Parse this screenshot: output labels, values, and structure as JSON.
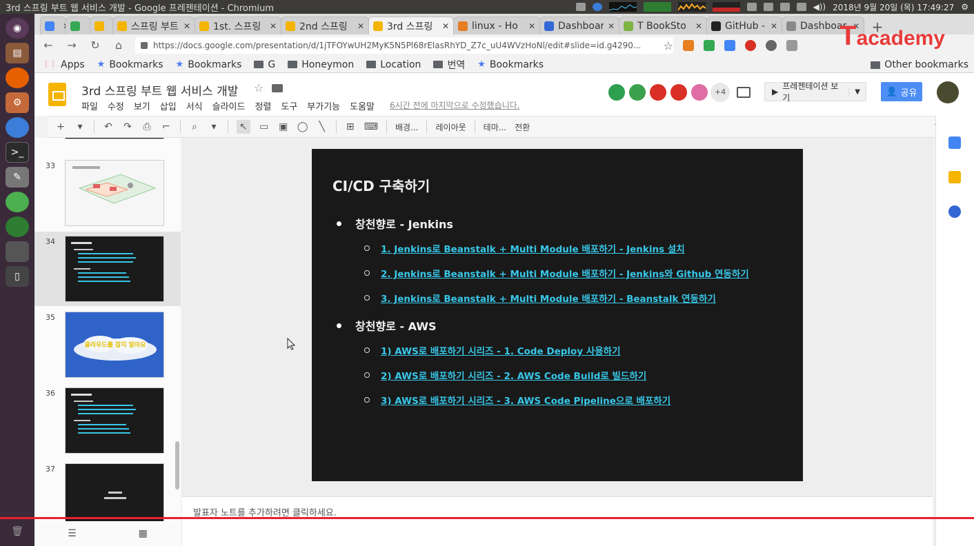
{
  "os": {
    "window_title": "3rd 스프링 부트 웹 서비스 개발 - Google 프레젠테이션 - Chromium",
    "clock": "2018년 9월 20일 (목) 17:49:27"
  },
  "launcher": [
    "ubuntu-dash-icon",
    "files-icon",
    "firefox-icon",
    "settings-icon",
    "chromium-icon",
    "terminal-icon",
    "text-editor-icon",
    "app-icon",
    "app-icon",
    "usb-icon",
    "trash-icon"
  ],
  "tabs": [
    {
      "label": "20",
      "color": "#4285f4"
    },
    {
      "label": "",
      "color": "#34a853"
    },
    {
      "label": "",
      "color": "#f4b400"
    },
    {
      "label": "스프링 부트",
      "color": "#f4b400"
    },
    {
      "label": "1st. 스프링",
      "color": "#f4b400"
    },
    {
      "label": "2nd 스프링",
      "color": "#f4b400"
    },
    {
      "label": "3rd 스프링",
      "color": "#f4b400",
      "active": true
    },
    {
      "label": "linux - Ho",
      "color": "#e67e22"
    },
    {
      "label": "Dashboar",
      "color": "#3367d6"
    },
    {
      "label": "T BookSto",
      "color": "#7cb342"
    },
    {
      "label": "GitHub - ",
      "color": "#222222"
    },
    {
      "label": "Dashboar",
      "color": "#888888"
    }
  ],
  "toolbar": {
    "url": "https://docs.google.com/presentation/d/1jTFOYwUH2MyK5N5Pl68rElasRhYD_Z7c_uU4WVzHoNl/edit#slide=id.g4290..."
  },
  "bookmarks": {
    "items": [
      {
        "label": "Apps",
        "icon": "apps-grid-icon"
      },
      {
        "label": "Bookmarks",
        "icon": "star-icon"
      },
      {
        "label": "Bookmarks",
        "icon": "star-icon"
      },
      {
        "label": "G",
        "icon": "folder-icon"
      },
      {
        "label": "Honeymon",
        "icon": "folder-icon"
      },
      {
        "label": "Location",
        "icon": "folder-icon"
      },
      {
        "label": "번역",
        "icon": "folder-icon"
      },
      {
        "label": "Bookmarks",
        "icon": "star-icon"
      }
    ],
    "other": "Other bookmarks"
  },
  "app": {
    "doc_title": "3rd 스프링 부트 웹 서비스 개발",
    "menu": [
      "파일",
      "수정",
      "보기",
      "삽입",
      "서식",
      "슬라이드",
      "정렬",
      "도구",
      "부가기능",
      "도움말"
    ],
    "last_edit": "6시간 전에 마지막으로 수정했습니다.",
    "collaborator_colors": [
      "#2e9e4f",
      "#3aa04b",
      "#d93025",
      "#d93025",
      "#e06ea5"
    ],
    "more_collaborators": "+4",
    "present_label": "프레젠테이션 보기",
    "share_label": "공유"
  },
  "edit_toolbar": {
    "background": "배경...",
    "layout": "레이아웃",
    "theme": "테마...",
    "transition": "전환"
  },
  "filmstrip": [
    {
      "num": "33",
      "kind": "diagram"
    },
    {
      "num": "34",
      "kind": "text",
      "selected": true
    },
    {
      "num": "35",
      "kind": "cloud",
      "caption": "클라우드를 잡지 말아요"
    },
    {
      "num": "36",
      "kind": "text"
    },
    {
      "num": "37",
      "kind": "dark"
    }
  ],
  "slide": {
    "title": "CI/CD 구축하기",
    "sections": [
      {
        "heading": "창천향로 - Jenkins",
        "links": [
          "1. Jenkins로 Beanstalk + Multi Module 배포하기 - Jenkins 설치",
          "2. Jenkins로 Beanstalk + Multi Module 배포하기 - Jenkins와 Github 연동하기",
          "3. Jenkins로 Beanstalk + Multi Module 배포하기 - Beanstalk 연동하기"
        ]
      },
      {
        "heading": "창천향로 - AWS",
        "links": [
          "1) AWS로 배포하기 시리즈 - 1. Code Deploy 사용하기",
          "2) AWS로 배포하기 시리즈 - 2. AWS Code Build로 빌드하기",
          "3) AWS로 배포하기 시리즈 - 3. AWS Code Pipeline으로 배포하기"
        ]
      }
    ]
  },
  "notes_placeholder": "발표자 노트를 추가하려면 클릭하세요.",
  "watermark": "Tacademy",
  "colors": {
    "accent": "#4d8df6",
    "link": "#38c7e8",
    "slide_bg": "#191919",
    "rec_line": "#e8212b"
  }
}
